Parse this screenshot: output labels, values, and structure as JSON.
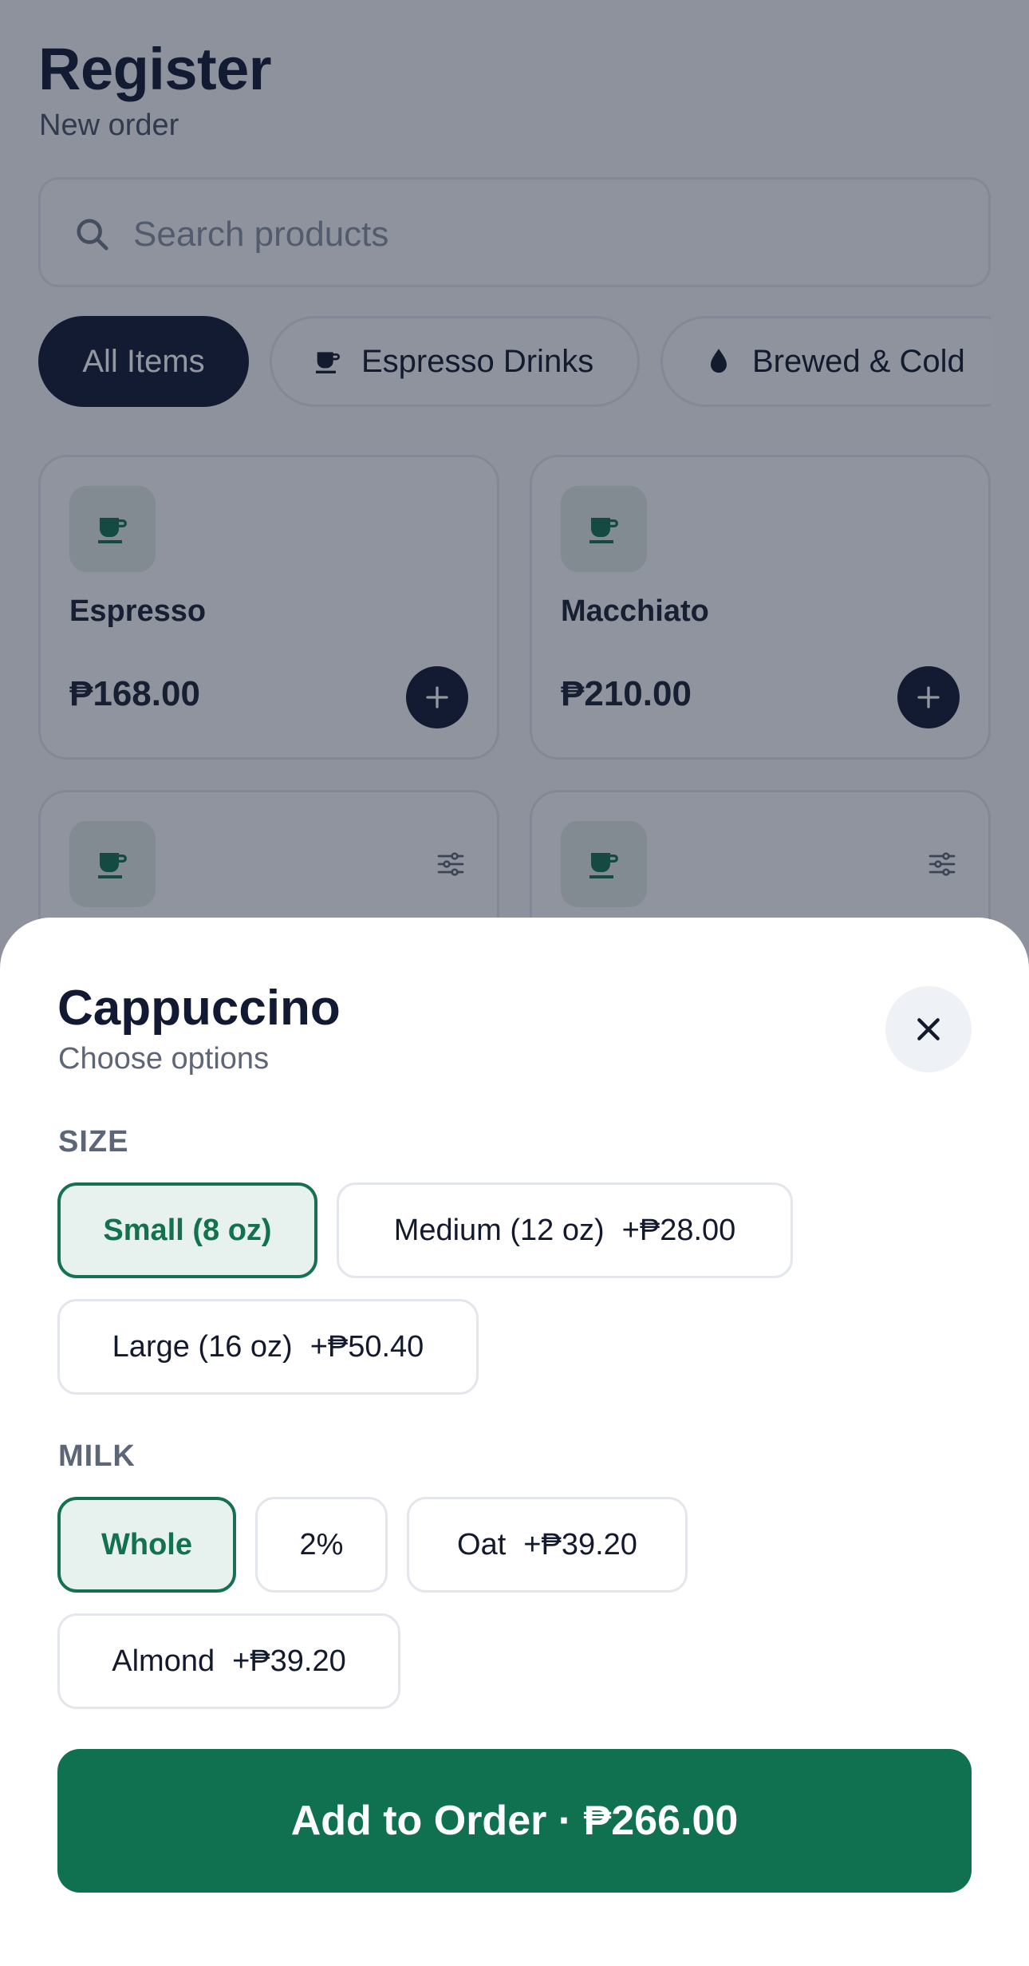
{
  "header": {
    "title": "Register",
    "subtitle": "New order"
  },
  "search": {
    "placeholder": "Search products"
  },
  "categories": [
    {
      "label": "All Items",
      "icon": "none",
      "active": true
    },
    {
      "label": "Espresso Drinks",
      "icon": "coffee-cup-icon",
      "active": false
    },
    {
      "label": "Brewed & Cold",
      "icon": "water-drop-icon",
      "active": false
    }
  ],
  "products": [
    {
      "name": "Espresso",
      "price": "₱168.00"
    },
    {
      "name": "Macchiato",
      "price": "₱210.00"
    }
  ],
  "modal": {
    "title": "Cappuccino",
    "subtitle": "Choose options",
    "size_label": "SIZE",
    "sizes": [
      {
        "label": "Small (8 oz)",
        "extra": "",
        "selected": true
      },
      {
        "label": "Medium (12 oz)",
        "extra": "+₱28.00",
        "selected": false
      },
      {
        "label": "Large (16 oz)",
        "extra": "+₱50.40",
        "selected": false
      }
    ],
    "milk_label": "MILK",
    "milks": [
      {
        "label": "Whole",
        "extra": "",
        "selected": true
      },
      {
        "label": "2%",
        "extra": "",
        "selected": false
      },
      {
        "label": "Oat",
        "extra": "+₱39.20",
        "selected": false
      },
      {
        "label": "Almond",
        "extra": "+₱39.20",
        "selected": false
      }
    ],
    "cta_label": "Add to Order · ₱266.00"
  },
  "colors": {
    "primary": "#0f7150",
    "dark": "#121a33",
    "selected_bg": "#e7f1ee",
    "icon_green": "#167152"
  }
}
